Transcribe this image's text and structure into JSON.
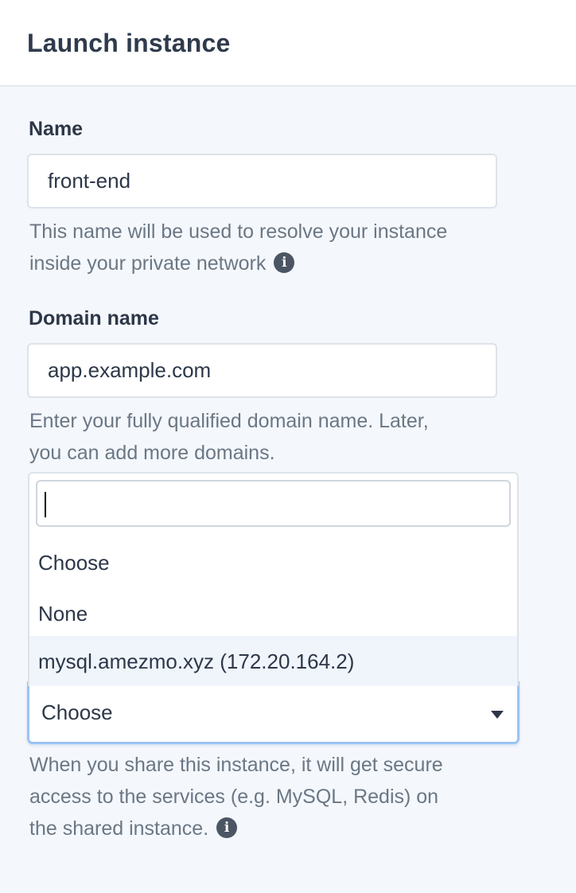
{
  "header": {
    "title": "Launch instance"
  },
  "name_field": {
    "label": "Name",
    "value": "front-end",
    "help_line1": "This name will be used to resolve your instance",
    "help_line2": "inside your private network"
  },
  "domain_field": {
    "label": "Domain name",
    "value": "app.example.com",
    "help_line1": "Enter your fully qualified domain name. Later,",
    "help_line2": "you can add more domains."
  },
  "share_field": {
    "selected": "Choose",
    "search_value": "",
    "options": [
      {
        "label": "Choose",
        "highlighted": false
      },
      {
        "label": "None",
        "highlighted": false
      },
      {
        "label": "mysql.amezmo.xyz (172.20.164.2)",
        "highlighted": true
      }
    ],
    "help_line1": "When you share this instance, it will get secure",
    "help_line2": "access to the services (e.g. MySQL, Redis) on",
    "help_line3": "the shared instance."
  },
  "icons": {
    "info": "info-icon",
    "caret": "chevron-down-icon"
  },
  "colors": {
    "focus_ring": "#9cc3f3",
    "highlight": "#f0f5fb",
    "info_icon": "#4b5563"
  }
}
